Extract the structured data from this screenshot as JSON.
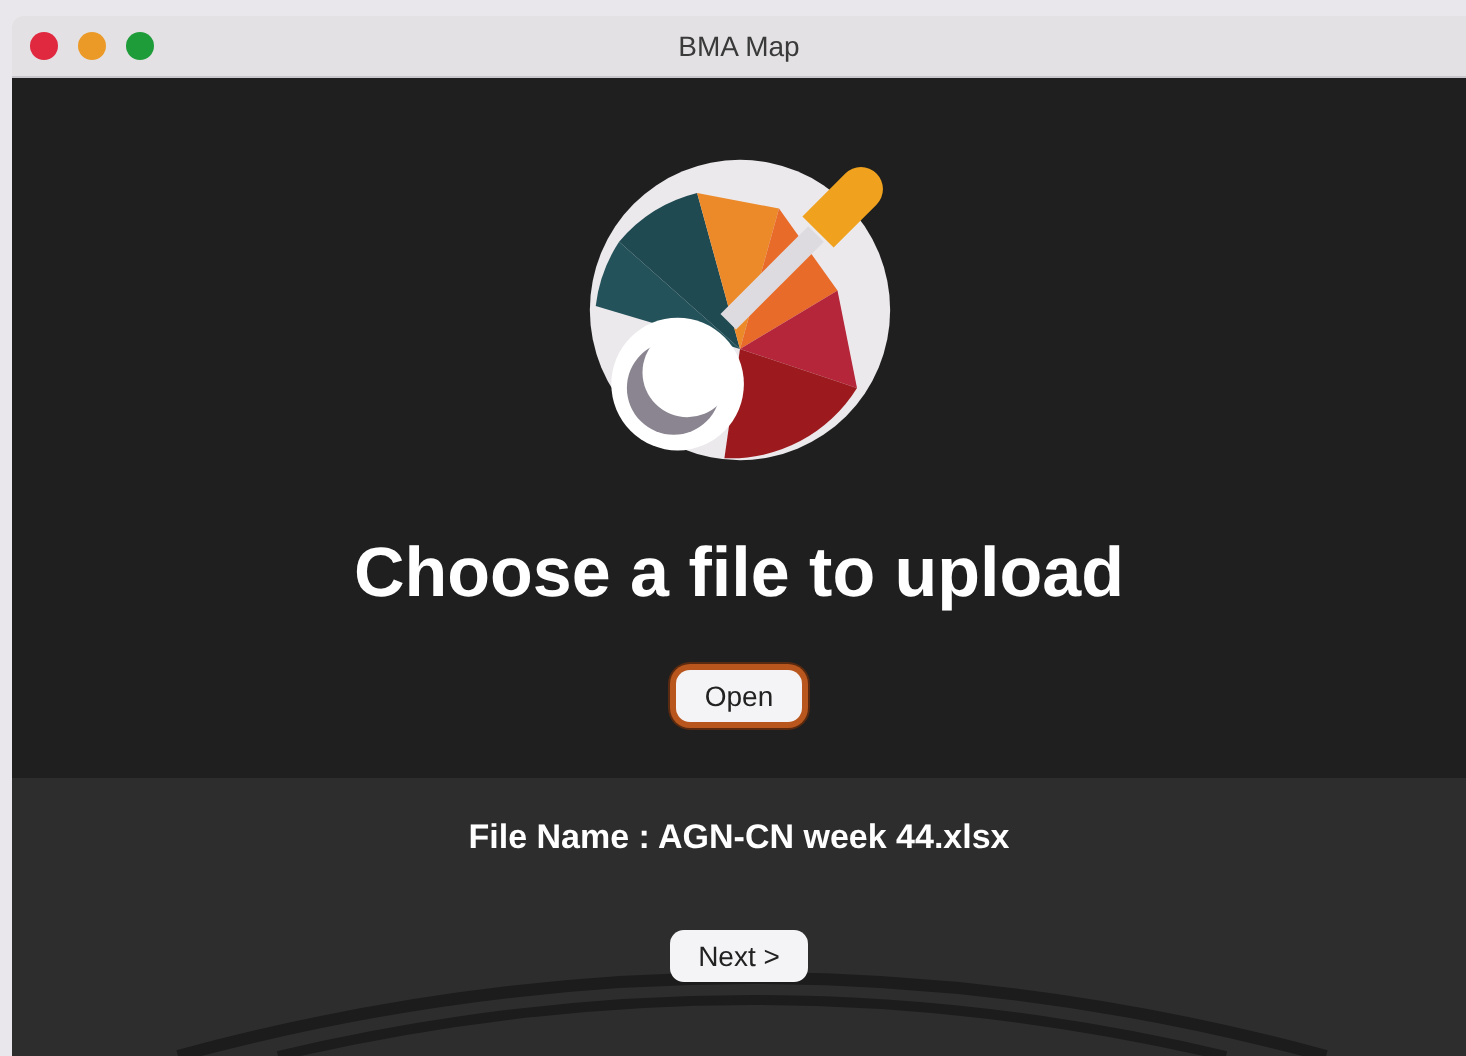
{
  "window": {
    "title": "BMA Map"
  },
  "heading": "Choose a file to upload",
  "open_button": {
    "label": "Open",
    "focused": true
  },
  "file_name": "File Name : AGN-CN week 44.xlsx",
  "next_button": {
    "label": "Next >",
    "focused": false
  }
}
